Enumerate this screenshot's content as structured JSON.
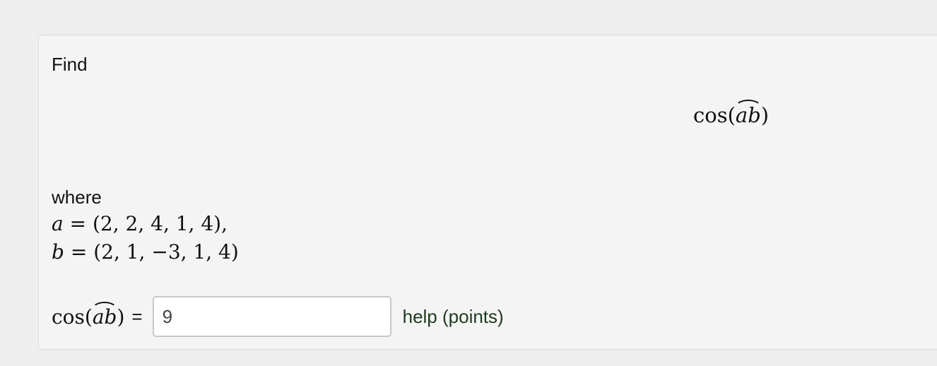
{
  "problem": {
    "find_label": "Find",
    "display_expr": {
      "fn": "cos",
      "open": "(",
      "arc_vars": "ab",
      "close": ")"
    },
    "where_label": "where",
    "vector_a": {
      "name": "a",
      "equals": " = ",
      "components": "(2, 2, 4, 1, 4),"
    },
    "vector_b": {
      "name": "b",
      "equals": " = ",
      "components": "(2, 1, −3, 1, 4)"
    }
  },
  "answer": {
    "label": {
      "fn": "cos",
      "open": "(",
      "arc_vars": "ab",
      "close": ")"
    },
    "equals": "=",
    "input_value": "9",
    "help_label": "help (points)"
  }
}
